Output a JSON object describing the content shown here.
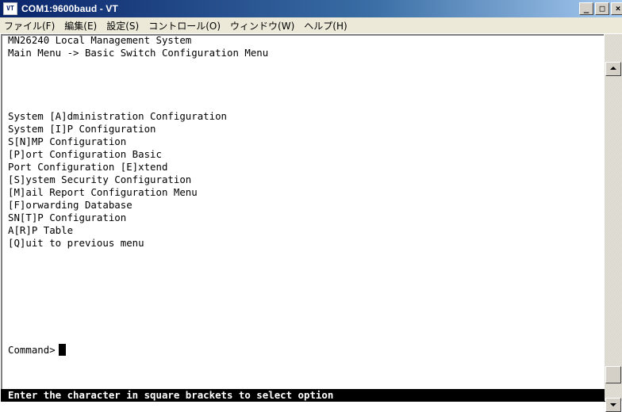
{
  "window": {
    "title": "COM1:9600baud - VT",
    "app_icon_text": "VT",
    "buttons": {
      "minimize": "_",
      "maximize": "□",
      "close": "×"
    }
  },
  "menubar": {
    "items": [
      "ファイル(F)",
      "編集(E)",
      "設定(S)",
      "コントロール(O)",
      "ウィンドウ(W)",
      "ヘルプ(H)"
    ]
  },
  "terminal": {
    "header_lines": [
      "MN26240 Local Management System",
      "Main Menu -> Basic Switch Configuration Menu"
    ],
    "menu_options": [
      "System [A]dministration Configuration",
      "System [I]P Configuration",
      "S[N]MP Configuration",
      "[P]ort Configuration Basic",
      "Port Configuration [E]xtend",
      "[S]ystem Security Configuration",
      "[M]ail Report Configuration Menu",
      "[F]orwarding Database",
      "SN[T]P Configuration",
      "A[R]P Table",
      "[Q]uit to previous menu"
    ],
    "command_prompt": "Command>",
    "status_message": "Enter the character in square brackets to select option"
  },
  "colors": {
    "terminal_bg": "#ffffff",
    "terminal_fg": "#000000",
    "status_bg": "#000000",
    "status_fg": "#ffffff",
    "titlebar_start": "#0a246a"
  }
}
